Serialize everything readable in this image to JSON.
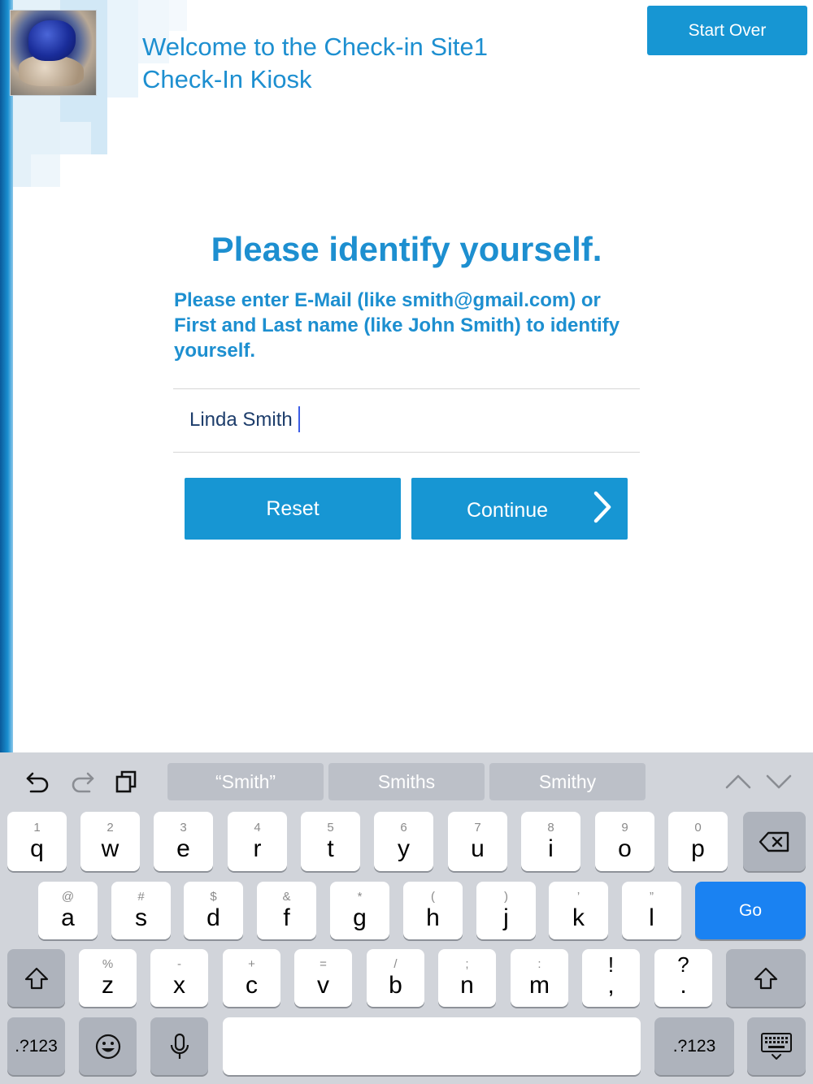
{
  "header": {
    "welcome_line1": "Welcome to the Check-in Site1",
    "welcome_line2": "Check-In Kiosk",
    "start_over": "Start Over"
  },
  "main": {
    "heading": "Please identify yourself.",
    "instructions": "Please enter E-Mail (like smith@gmail.com) or First and Last name (like John Smith) to identify yourself.",
    "input_value": "Linda Smith",
    "reset_label": "Reset",
    "continue_label": "Continue"
  },
  "keyboard": {
    "suggestions": [
      "“Smith”",
      "Smiths",
      "Smithy"
    ],
    "row1": [
      {
        "sub": "1",
        "main": "q"
      },
      {
        "sub": "2",
        "main": "w"
      },
      {
        "sub": "3",
        "main": "e"
      },
      {
        "sub": "4",
        "main": "r"
      },
      {
        "sub": "5",
        "main": "t"
      },
      {
        "sub": "6",
        "main": "y"
      },
      {
        "sub": "7",
        "main": "u"
      },
      {
        "sub": "8",
        "main": "i"
      },
      {
        "sub": "9",
        "main": "o"
      },
      {
        "sub": "0",
        "main": "p"
      }
    ],
    "row2": [
      {
        "sub": "@",
        "main": "a"
      },
      {
        "sub": "#",
        "main": "s"
      },
      {
        "sub": "$",
        "main": "d"
      },
      {
        "sub": "&",
        "main": "f"
      },
      {
        "sub": "*",
        "main": "g"
      },
      {
        "sub": "(",
        "main": "h"
      },
      {
        "sub": ")",
        "main": "j"
      },
      {
        "sub": "’",
        "main": "k"
      },
      {
        "sub": "”",
        "main": "l"
      }
    ],
    "row3": [
      {
        "sub": "%",
        "main": "z"
      },
      {
        "sub": "-",
        "main": "x"
      },
      {
        "sub": "+",
        "main": "c"
      },
      {
        "sub": "=",
        "main": "v"
      },
      {
        "sub": "/",
        "main": "b"
      },
      {
        "sub": ";",
        "main": "n"
      },
      {
        "sub": ":",
        "main": "m"
      },
      {
        "sub": "!",
        "main": ","
      },
      {
        "sub": "?",
        "main": "."
      }
    ],
    "go_label": "Go",
    "numbers_label": ".?123",
    "emoji_icon": "emoji-icon",
    "mic_icon": "microphone-icon"
  }
}
